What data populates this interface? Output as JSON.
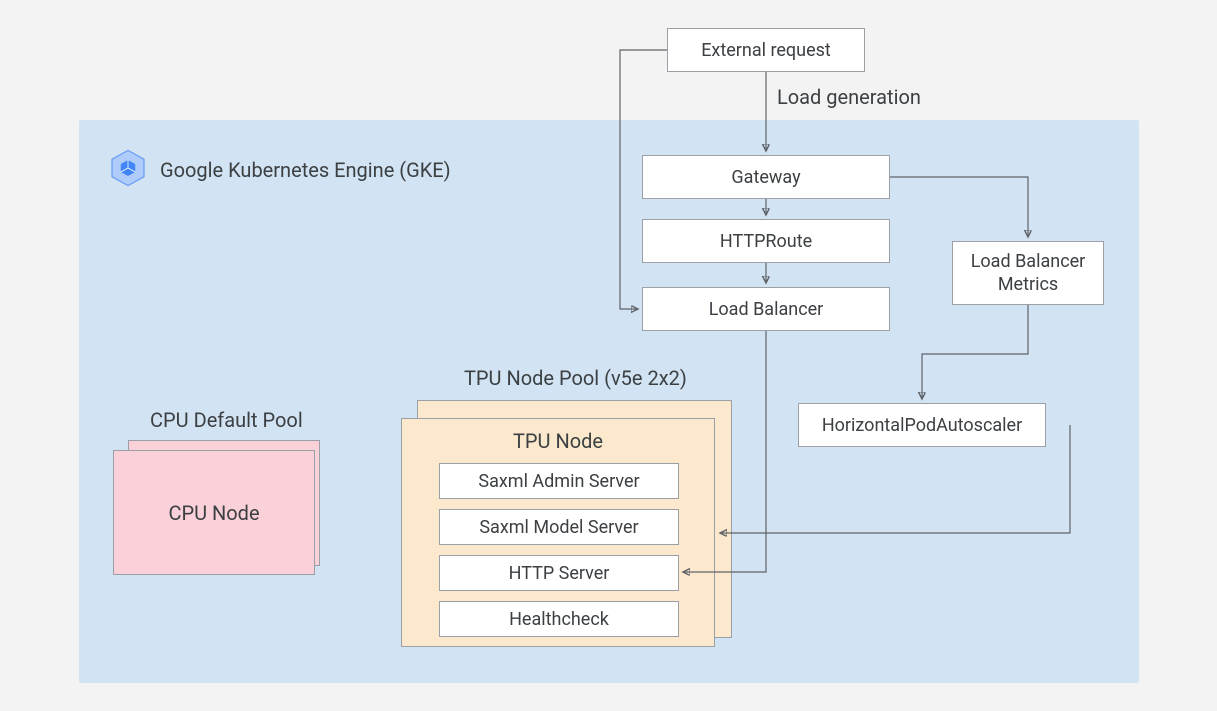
{
  "external_request": "External request",
  "load_generation_label": "Load generation",
  "gke_title": "Google Kubernetes Engine (GKE)",
  "gateway": "Gateway",
  "httproute": "HTTPRoute",
  "load_balancer": "Load Balancer",
  "lb_metrics": "Load Balancer Metrics",
  "hpa": "HorizontalPodAutoscaler",
  "cpu_pool_label": "CPU Default Pool",
  "cpu_node": "CPU Node",
  "tpu_pool_label": "TPU Node Pool (v5e 2x2)",
  "tpu_node_title": "TPU Node",
  "tpu_components": {
    "admin": "Saxml Admin Server",
    "model": "Saxml Model Server",
    "http": "HTTP Server",
    "health": "Healthcheck"
  }
}
